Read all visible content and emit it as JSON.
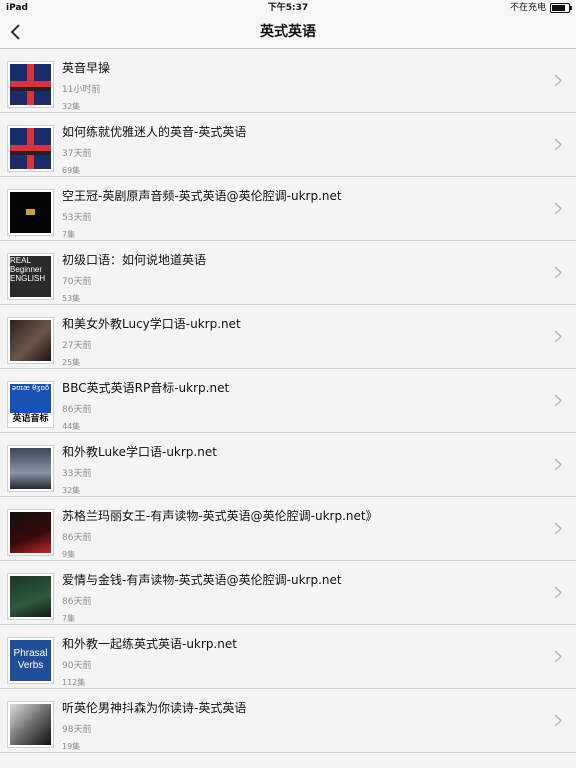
{
  "status": {
    "device": "iPad",
    "time": "下午5:37",
    "charge": "不在充电"
  },
  "nav": {
    "title": "英式英语"
  },
  "items": [
    {
      "title": "英音早操",
      "time": "11小时前",
      "count": "32集",
      "art": "uk",
      "art_text": ""
    },
    {
      "title": "如何练就优雅迷人的英音-英式英语",
      "time": "37天前",
      "count": "69集",
      "art": "uk",
      "art_text": ""
    },
    {
      "title": "空王冠-英剧原声音频-英式英语@英伦腔调-ukrp.net",
      "time": "53天前",
      "count": "7集",
      "art": "crown",
      "art_text": ""
    },
    {
      "title": "初级口语：如何说地道英语",
      "time": "70天前",
      "count": "53集",
      "art": "real",
      "art_text": "REAL Beginner ENGLISH"
    },
    {
      "title": "和美女外教Lucy学口语-ukrp.net",
      "time": "27天前",
      "count": "25集",
      "art": "portrait",
      "art_text": ""
    },
    {
      "title": "BBC英式英语RP音标-ukrp.net",
      "time": "86天前",
      "count": "44集",
      "art": "phon",
      "art_text": "əʊɪæ θʒɒð",
      "art_label": "英语音标"
    },
    {
      "title": "和外教Luke学口语-ukrp.net",
      "time": "33天前",
      "count": "32集",
      "art": "city",
      "art_text": ""
    },
    {
      "title": "苏格兰玛丽女王-有声读物-英式英语@英伦腔调-ukrp.net》",
      "time": "86天前",
      "count": "9集",
      "art": "queen",
      "art_text": ""
    },
    {
      "title": "爱情与金钱-有声读物-英式英语@英伦腔调-ukrp.net",
      "time": "86天前",
      "count": "7集",
      "art": "money",
      "art_text": ""
    },
    {
      "title": "和外教一起练英式英语-ukrp.net",
      "time": "90天前",
      "count": "112集",
      "art": "phrasal",
      "art_text": "Phrasal Verbs"
    },
    {
      "title": "听英伦男神抖森为你读诗-英式英语",
      "time": "98天前",
      "count": "19集",
      "art": "man",
      "art_text": ""
    }
  ]
}
